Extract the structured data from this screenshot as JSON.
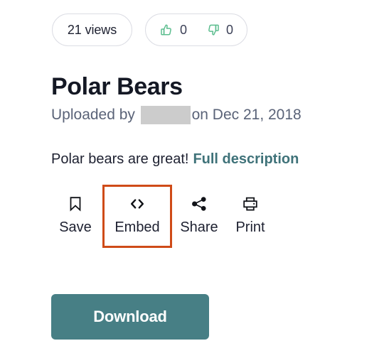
{
  "stats": {
    "views_label": "21 views",
    "upvote_count": "0",
    "downvote_count": "0",
    "upvote_icon": "thumbs-up-icon",
    "downvote_icon": "thumbs-down-icon",
    "vote_icon_color": "#5bbd8e"
  },
  "title": "Polar Bears",
  "upload": {
    "prefix": "Uploaded by ",
    "author_redacted": true,
    "suffix": " on Dec 21, 2018",
    "redaction_color": "#cccccc"
  },
  "description": {
    "text": "Polar bears are great!",
    "link_label": "Full description",
    "link_color": "#3f7279"
  },
  "actions": [
    {
      "label": "Save",
      "icon": "bookmark-icon",
      "highlighted": false
    },
    {
      "label": "Embed",
      "icon": "code-brackets-icon",
      "highlighted": true
    },
    {
      "label": "Share",
      "icon": "share-nodes-icon",
      "highlighted": false
    },
    {
      "label": "Print",
      "icon": "printer-icon",
      "highlighted": false
    }
  ],
  "highlight_color": "#cf4b18",
  "download": {
    "label": "Download",
    "color": "#477f85"
  }
}
